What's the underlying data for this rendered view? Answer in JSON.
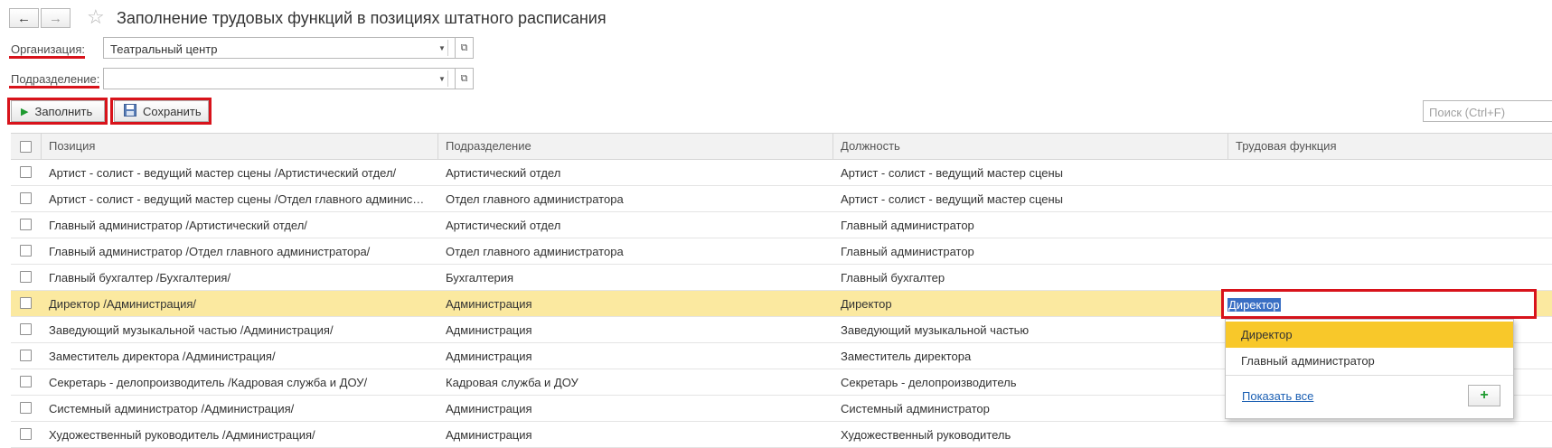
{
  "header": {
    "back_glyph": "←",
    "forward_glyph": "→",
    "star_glyph": "☆",
    "title": "Заполнение трудовых функций в позициях штатного расписания"
  },
  "filters": {
    "organization_label": "Организация:",
    "organization_value": "Театральный центр",
    "subdivision_label": "Подразделение:",
    "subdivision_value": ""
  },
  "toolbar": {
    "fill_label": "Заполнить",
    "save_label": "Сохранить",
    "search_placeholder": "Поиск (Ctrl+F)"
  },
  "table": {
    "columns": [
      "Позиция",
      "Подразделение",
      "Должность",
      "Трудовая функция"
    ],
    "rows": [
      {
        "position": "Артист - солист - ведущий мастер сцены /Артистический отдел/",
        "subdivision": "Артистический отдел",
        "post": "Артист - солист - ведущий мастер сцены",
        "function": ""
      },
      {
        "position": "Артист - солист - ведущий мастер сцены /Отдел главного админис…",
        "subdivision": "Отдел главного администратора",
        "post": "Артист - солист - ведущий мастер сцены",
        "function": ""
      },
      {
        "position": "Главный администратор /Артистический отдел/",
        "subdivision": "Артистический отдел",
        "post": "Главный администратор",
        "function": ""
      },
      {
        "position": "Главный администратор /Отдел главного администратора/",
        "subdivision": "Отдел главного администратора",
        "post": "Главный администратор",
        "function": ""
      },
      {
        "position": "Главный бухгалтер /Бухгалтерия/",
        "subdivision": "Бухгалтерия",
        "post": "Главный бухгалтер",
        "function": ""
      },
      {
        "position": "Директор /Администрация/",
        "subdivision": "Администрация",
        "post": "Директор",
        "function": ""
      },
      {
        "position": "Заведующий музыкальной частью /Администрация/",
        "subdivision": "Администрация",
        "post": "Заведующий музыкальной частью",
        "function": ""
      },
      {
        "position": "Заместитель директора /Администрация/",
        "subdivision": "Администрация",
        "post": "Заместитель директора",
        "function": ""
      },
      {
        "position": "Секретарь - делопроизводитель /Кадровая служба и ДОУ/",
        "subdivision": "Кадровая служба и ДОУ",
        "post": "Секретарь - делопроизводитель",
        "function": ""
      },
      {
        "position": "Системный администратор /Администрация/",
        "subdivision": "Администрация",
        "post": "Системный администратор",
        "function": ""
      },
      {
        "position": "Художественный руководитель /Администрация/",
        "subdivision": "Администрация",
        "post": "Художественный руководитель",
        "function": ""
      }
    ]
  },
  "editor": {
    "value": "Директор",
    "options": [
      "Директор",
      "Главный администратор"
    ],
    "show_all": "Показать все",
    "add_glyph": "+"
  },
  "colors": {
    "accent_red": "#d8131b",
    "selected_row": "#fbe9a0",
    "highlight_option": "#f8c82a",
    "link": "#1b5fb3"
  }
}
